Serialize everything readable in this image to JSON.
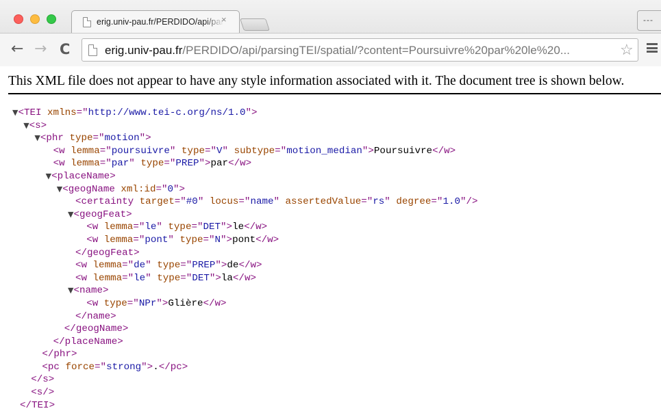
{
  "browser": {
    "tab_title": "erig.univ-pau.fr/PERDIDO/api/parsingTEI/spatial/",
    "tab_close": "×",
    "url_host": "erig.univ-pau.fr",
    "url_path": "/PERDIDO/api/parsingTEI/spatial/?content=Poursuivre%20par%20le%20...",
    "user_button_label": "---",
    "icons": {
      "back": "back-arrow-icon",
      "forward": "forward-arrow-icon",
      "reload": "reload-icon",
      "page": "page-icon",
      "star": "star-icon",
      "menu": "menu-icon"
    }
  },
  "page": {
    "notice": "This XML file does not appear to have any style information associated with it. The document tree is shown below.",
    "xml": [
      {
        "indent": 0,
        "arrow": true,
        "parts": [
          [
            "tag",
            "<TEI "
          ],
          [
            "attr",
            "xmlns"
          ],
          [
            "tag",
            "=\""
          ],
          [
            "val",
            "http://www.tei-c.org/ns/1.0"
          ],
          [
            "tag",
            "\">"
          ]
        ]
      },
      {
        "indent": 1,
        "arrow": true,
        "parts": [
          [
            "tag",
            "<s>"
          ]
        ]
      },
      {
        "indent": 2,
        "arrow": true,
        "parts": [
          [
            "tag",
            "<phr "
          ],
          [
            "attr",
            "type"
          ],
          [
            "tag",
            "=\""
          ],
          [
            "val",
            "motion"
          ],
          [
            "tag",
            "\">"
          ]
        ]
      },
      {
        "indent": 3,
        "arrow": false,
        "parts": [
          [
            "tag",
            "<w "
          ],
          [
            "attr",
            "lemma"
          ],
          [
            "tag",
            "=\""
          ],
          [
            "val",
            "poursuivre"
          ],
          [
            "tag",
            "\" "
          ],
          [
            "attr",
            "type"
          ],
          [
            "tag",
            "=\""
          ],
          [
            "val",
            "V"
          ],
          [
            "tag",
            "\" "
          ],
          [
            "attr",
            "subtype"
          ],
          [
            "tag",
            "=\""
          ],
          [
            "val",
            "motion_median"
          ],
          [
            "tag",
            "\">"
          ],
          [
            "txt",
            "Poursuivre"
          ],
          [
            "tag",
            "</w>"
          ]
        ]
      },
      {
        "indent": 3,
        "arrow": false,
        "parts": [
          [
            "tag",
            "<w "
          ],
          [
            "attr",
            "lemma"
          ],
          [
            "tag",
            "=\""
          ],
          [
            "val",
            "par"
          ],
          [
            "tag",
            "\" "
          ],
          [
            "attr",
            "type"
          ],
          [
            "tag",
            "=\""
          ],
          [
            "val",
            "PREP"
          ],
          [
            "tag",
            "\">"
          ],
          [
            "txt",
            "par"
          ],
          [
            "tag",
            "</w>"
          ]
        ]
      },
      {
        "indent": 3,
        "arrow": true,
        "parts": [
          [
            "tag",
            "<placeName>"
          ]
        ]
      },
      {
        "indent": 4,
        "arrow": true,
        "parts": [
          [
            "tag",
            "<geogName "
          ],
          [
            "attr",
            "xml:id"
          ],
          [
            "tag",
            "=\""
          ],
          [
            "val",
            "0"
          ],
          [
            "tag",
            "\">"
          ]
        ]
      },
      {
        "indent": 5,
        "arrow": false,
        "parts": [
          [
            "tag",
            "<certainty "
          ],
          [
            "attr",
            "target"
          ],
          [
            "tag",
            "=\""
          ],
          [
            "val",
            "#0"
          ],
          [
            "tag",
            "\" "
          ],
          [
            "attr",
            "locus"
          ],
          [
            "tag",
            "=\""
          ],
          [
            "val",
            "name"
          ],
          [
            "tag",
            "\" "
          ],
          [
            "attr",
            "assertedValue"
          ],
          [
            "tag",
            "=\""
          ],
          [
            "val",
            "rs"
          ],
          [
            "tag",
            "\" "
          ],
          [
            "attr",
            "degree"
          ],
          [
            "tag",
            "=\""
          ],
          [
            "val",
            "1.0"
          ],
          [
            "tag",
            "\"/>"
          ]
        ]
      },
      {
        "indent": 5,
        "arrow": true,
        "parts": [
          [
            "tag",
            "<geogFeat>"
          ]
        ]
      },
      {
        "indent": 6,
        "arrow": false,
        "parts": [
          [
            "tag",
            "<w "
          ],
          [
            "attr",
            "lemma"
          ],
          [
            "tag",
            "=\""
          ],
          [
            "val",
            "le"
          ],
          [
            "tag",
            "\" "
          ],
          [
            "attr",
            "type"
          ],
          [
            "tag",
            "=\""
          ],
          [
            "val",
            "DET"
          ],
          [
            "tag",
            "\">"
          ],
          [
            "txt",
            "le"
          ],
          [
            "tag",
            "</w>"
          ]
        ]
      },
      {
        "indent": 6,
        "arrow": false,
        "parts": [
          [
            "tag",
            "<w "
          ],
          [
            "attr",
            "lemma"
          ],
          [
            "tag",
            "=\""
          ],
          [
            "val",
            "pont"
          ],
          [
            "tag",
            "\" "
          ],
          [
            "attr",
            "type"
          ],
          [
            "tag",
            "=\""
          ],
          [
            "val",
            "N"
          ],
          [
            "tag",
            "\">"
          ],
          [
            "txt",
            "pont"
          ],
          [
            "tag",
            "</w>"
          ]
        ]
      },
      {
        "indent": 5,
        "arrow": false,
        "parts": [
          [
            "tag",
            "</geogFeat>"
          ]
        ]
      },
      {
        "indent": 5,
        "arrow": false,
        "parts": [
          [
            "tag",
            "<w "
          ],
          [
            "attr",
            "lemma"
          ],
          [
            "tag",
            "=\""
          ],
          [
            "val",
            "de"
          ],
          [
            "tag",
            "\" "
          ],
          [
            "attr",
            "type"
          ],
          [
            "tag",
            "=\""
          ],
          [
            "val",
            "PREP"
          ],
          [
            "tag",
            "\">"
          ],
          [
            "txt",
            "de"
          ],
          [
            "tag",
            "</w>"
          ]
        ]
      },
      {
        "indent": 5,
        "arrow": false,
        "parts": [
          [
            "tag",
            "<w "
          ],
          [
            "attr",
            "lemma"
          ],
          [
            "tag",
            "=\""
          ],
          [
            "val",
            "le"
          ],
          [
            "tag",
            "\" "
          ],
          [
            "attr",
            "type"
          ],
          [
            "tag",
            "=\""
          ],
          [
            "val",
            "DET"
          ],
          [
            "tag",
            "\">"
          ],
          [
            "txt",
            "la"
          ],
          [
            "tag",
            "</w>"
          ]
        ]
      },
      {
        "indent": 5,
        "arrow": true,
        "parts": [
          [
            "tag",
            "<name>"
          ]
        ]
      },
      {
        "indent": 6,
        "arrow": false,
        "parts": [
          [
            "tag",
            "<w "
          ],
          [
            "attr",
            "type"
          ],
          [
            "tag",
            "=\""
          ],
          [
            "val",
            "NPr"
          ],
          [
            "tag",
            "\">"
          ],
          [
            "txt",
            "Glière"
          ],
          [
            "tag",
            "</w>"
          ]
        ]
      },
      {
        "indent": 5,
        "arrow": false,
        "parts": [
          [
            "tag",
            "</name>"
          ]
        ]
      },
      {
        "indent": 4,
        "arrow": false,
        "parts": [
          [
            "tag",
            "</geogName>"
          ]
        ]
      },
      {
        "indent": 3,
        "arrow": false,
        "parts": [
          [
            "tag",
            "</placeName>"
          ]
        ]
      },
      {
        "indent": 2,
        "arrow": false,
        "parts": [
          [
            "tag",
            "</phr>"
          ]
        ]
      },
      {
        "indent": 2,
        "arrow": false,
        "parts": [
          [
            "tag",
            "<pc "
          ],
          [
            "attr",
            "force"
          ],
          [
            "tag",
            "=\""
          ],
          [
            "val",
            "strong"
          ],
          [
            "tag",
            "\">"
          ],
          [
            "txt",
            "."
          ],
          [
            "tag",
            "</pc>"
          ]
        ]
      },
      {
        "indent": 1,
        "arrow": false,
        "parts": [
          [
            "tag",
            "</s>"
          ]
        ]
      },
      {
        "indent": 1,
        "arrow": false,
        "parts": [
          [
            "tag",
            "<s/>"
          ]
        ]
      },
      {
        "indent": 0,
        "arrow": false,
        "parts": [
          [
            "tag",
            "</TEI>"
          ]
        ]
      }
    ]
  }
}
